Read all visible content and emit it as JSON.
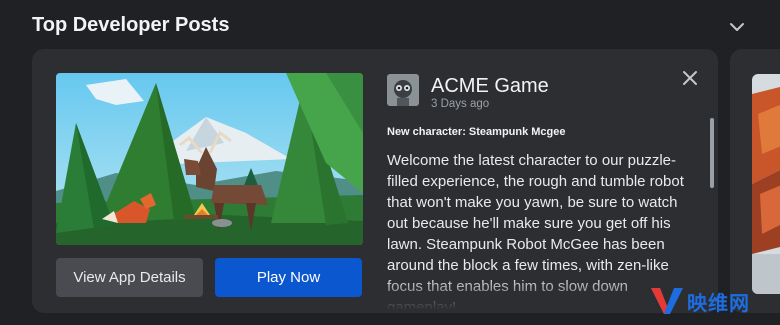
{
  "section": {
    "title": "Top Developer Posts",
    "toggle_icon": "chevron-down-icon"
  },
  "post": {
    "game_name": "ACME Game",
    "posted_ago": "3 Days ago",
    "subtitle": "New character: Steampunk Mcgee",
    "body": "Welcome the latest character to our puzzle-filled experience, the rough and tumble robot that won't make you yawn, be sure to watch out because he'll make sure you get off his lawn. Steampunk Robot McGee has been around the block a few times, with zen-like focus that enables him to slow down gameplay!",
    "close_icon": "close-icon"
  },
  "buttons": {
    "details_label": "View App Details",
    "play_label": "Play Now"
  },
  "watermark": {
    "text": "映维网"
  },
  "colors": {
    "page_bg": "#202124",
    "card_bg": "#2d2e31",
    "secondary_button": "#494b50",
    "primary_button": "#0b57d0",
    "watermark": "#1d6ce0"
  }
}
